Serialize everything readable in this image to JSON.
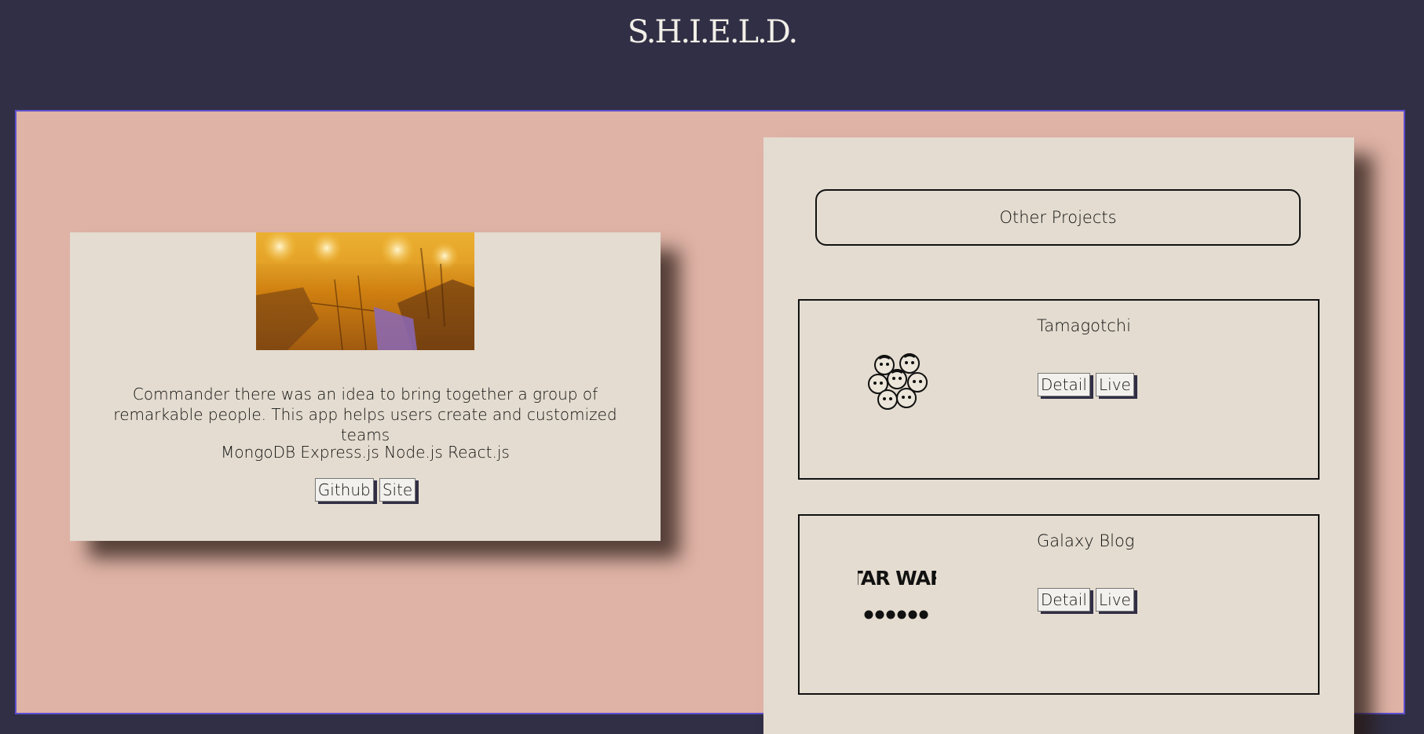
{
  "site": {
    "title": "S.H.I.E.L.D."
  },
  "feature": {
    "description": "Commander there was an idea to bring together a group of remarkable people. This app helps users create and customized teams",
    "tech": "MongoDB Express.js Node.js React.js",
    "github_label": "Github",
    "site_label": "Site"
  },
  "other_projects": {
    "heading": "Other Projects",
    "items": [
      {
        "title": "Tamagotchi",
        "detail_label": "Detail",
        "live_label": "Live",
        "logo": "tamagotchi-faces-icon"
      },
      {
        "title": "Galaxy Blog",
        "detail_label": "Detail",
        "live_label": "Live",
        "logo": "star-wars-logo",
        "logo_text": "STAR WARS"
      }
    ]
  }
}
